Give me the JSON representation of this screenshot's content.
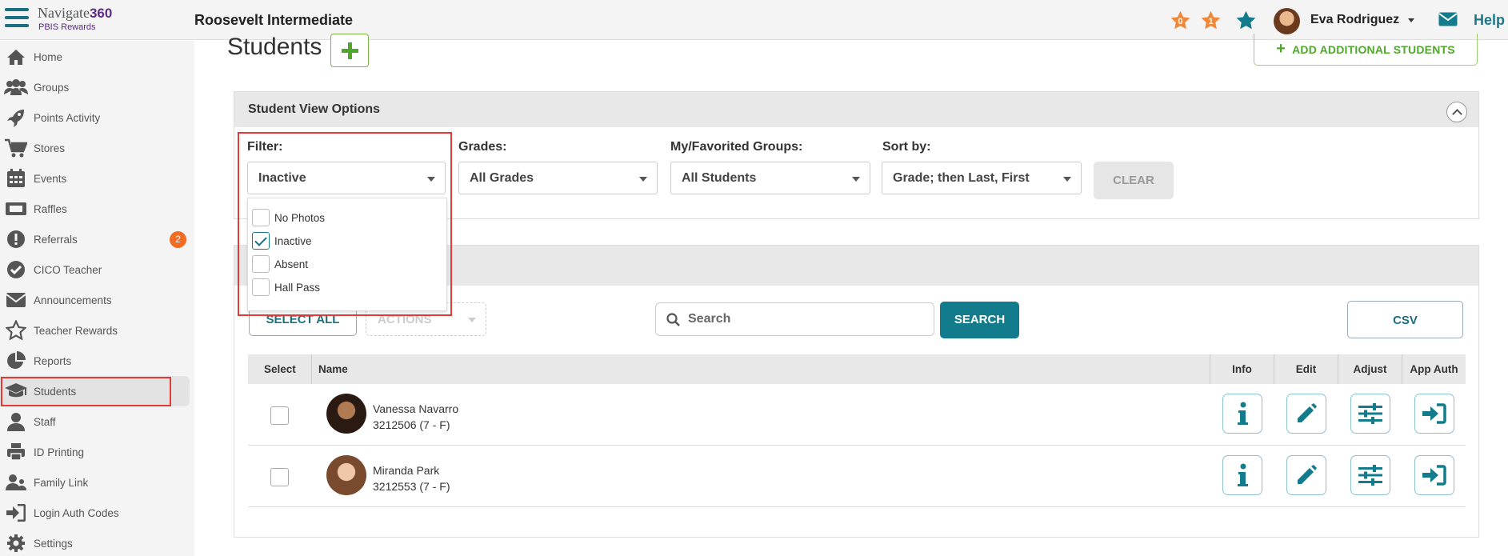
{
  "header": {
    "logo_text": "Navigate",
    "logo_number": "360",
    "logo_sub": "PBIS Rewards",
    "school": "Roosevelt Intermediate",
    "user_name": "Eva Rodriguez",
    "help": "Help"
  },
  "sidebar": {
    "items": [
      {
        "label": "Home",
        "icon": "home-icon"
      },
      {
        "label": "Groups",
        "icon": "groups-icon"
      },
      {
        "label": "Points Activity",
        "icon": "rocket-icon"
      },
      {
        "label": "Stores",
        "icon": "cart-icon"
      },
      {
        "label": "Events",
        "icon": "calendar-icon"
      },
      {
        "label": "Raffles",
        "icon": "ticket-icon"
      },
      {
        "label": "Referrals",
        "icon": "alert-icon",
        "badge": "2"
      },
      {
        "label": "CICO Teacher",
        "icon": "check-circle-icon"
      },
      {
        "label": "Announcements",
        "icon": "envelope-icon"
      },
      {
        "label": "Teacher Rewards",
        "icon": "star-icon"
      },
      {
        "label": "Reports",
        "icon": "pie-chart-icon"
      },
      {
        "label": "Students",
        "icon": "graduation-cap-icon",
        "active": true
      },
      {
        "label": "Staff",
        "icon": "person-icon"
      },
      {
        "label": "ID Printing",
        "icon": "printer-icon"
      },
      {
        "label": "Family Link",
        "icon": "family-icon"
      },
      {
        "label": "Login Auth Codes",
        "icon": "sign-in-icon"
      },
      {
        "label": "Settings",
        "icon": "gear-icon"
      }
    ]
  },
  "main": {
    "title": "Students",
    "add_additional": "ADD ADDITIONAL STUDENTS",
    "view_options": {
      "title": "Student View Options",
      "filter_label": "Filter:",
      "filter_value": "Inactive",
      "grades_label": "Grades:",
      "grades_value": "All Grades",
      "groups_label": "My/Favorited Groups:",
      "groups_value": "All Students",
      "sort_label": "Sort by:",
      "sort_value": "Grade; then Last, First",
      "clear": "CLEAR"
    },
    "filter_options": [
      {
        "label": "No Photos",
        "checked": false
      },
      {
        "label": "Inactive",
        "checked": true
      },
      {
        "label": "Absent",
        "checked": false
      },
      {
        "label": "Hall Pass",
        "checked": false
      }
    ],
    "toolbar": {
      "select_all": "SELECT ALL",
      "actions": "ACTIONS",
      "search_placeholder": "Search",
      "search_button": "SEARCH",
      "csv": "CSV"
    },
    "table": {
      "headers": [
        "Select",
        "Name",
        "Info",
        "Edit",
        "Adjust",
        "App Auth"
      ],
      "rows": [
        {
          "name": "Vanessa Navarro",
          "id": "3212506 (7 - F)"
        },
        {
          "name": "Miranda Park",
          "id": "3212553 (7 - F)"
        }
      ]
    }
  },
  "colors": {
    "teal": "#137c8c",
    "green": "#4fa82a",
    "orange": "#f26b22",
    "highlight_red": "#e53935"
  }
}
